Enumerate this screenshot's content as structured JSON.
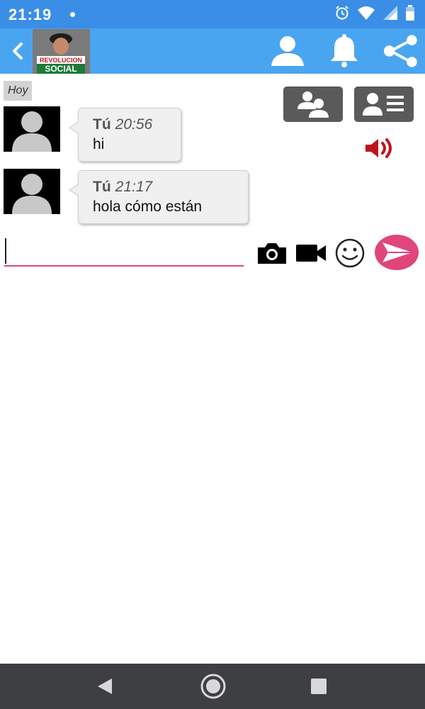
{
  "status_bar": {
    "time": "21:19",
    "icons": [
      "alarm-icon",
      "wifi-icon",
      "signal-icon",
      "battery-icon"
    ]
  },
  "app_bar": {
    "back_icon": "chevron-left-icon",
    "channel_logo": {
      "line1": "REVOLUCION",
      "line2": "SOCIAL"
    },
    "actions": [
      "profile-icon",
      "bell-icon",
      "share-icon"
    ]
  },
  "chat": {
    "day_label": "Hoy",
    "messages": [
      {
        "author": "Tú",
        "time": "20:56",
        "text": "hi"
      },
      {
        "author": "Tú",
        "time": "21:17",
        "text": "hola cómo están"
      }
    ],
    "tools": [
      "group-users-icon",
      "contact-card-icon",
      "speaker-icon"
    ]
  },
  "composer": {
    "placeholder": "",
    "value": "",
    "actions": [
      "camera-icon",
      "video-icon",
      "emoji-icon",
      "send-icon"
    ]
  },
  "nav_bar": [
    "back-triangle-icon",
    "home-circle-icon",
    "recents-square-icon"
  ],
  "colors": {
    "status_bar": "#3a8ee6",
    "app_bar": "#4aa5f0",
    "accent": "#e0457b",
    "speaker": "#c0141c",
    "tool_button": "#5a5a5a",
    "nav_bar": "#3d3f42"
  }
}
